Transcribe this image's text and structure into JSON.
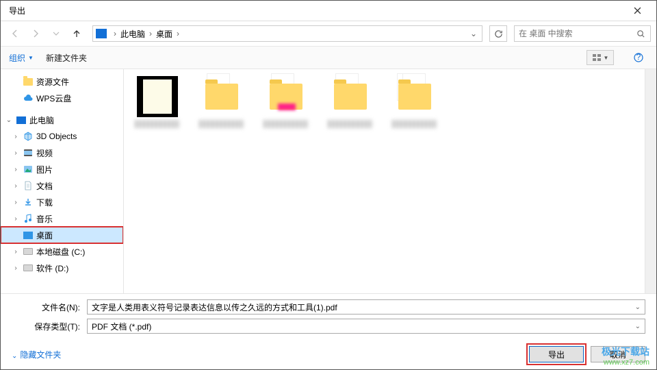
{
  "title": "导出",
  "nav": {
    "crumbs": [
      "此电脑",
      "桌面"
    ],
    "search_placeholder": "在 桌面 中搜索"
  },
  "toolbar": {
    "organize": "组织",
    "new_folder": "新建文件夹"
  },
  "sidebar": [
    {
      "label": "资源文件",
      "icon": "folder",
      "indent": 1,
      "caret": ""
    },
    {
      "label": "WPS云盘",
      "icon": "cloud",
      "indent": 1,
      "caret": ""
    },
    {
      "label": "此电脑",
      "icon": "pc",
      "indent": 0,
      "caret": "v"
    },
    {
      "label": "3D Objects",
      "icon": "3d",
      "indent": 1,
      "caret": ">"
    },
    {
      "label": "视频",
      "icon": "video",
      "indent": 1,
      "caret": ">"
    },
    {
      "label": "图片",
      "icon": "image",
      "indent": 1,
      "caret": ">"
    },
    {
      "label": "文档",
      "icon": "doc",
      "indent": 1,
      "caret": ">"
    },
    {
      "label": "下载",
      "icon": "download",
      "indent": 1,
      "caret": ">"
    },
    {
      "label": "音乐",
      "icon": "music",
      "indent": 1,
      "caret": ">"
    },
    {
      "label": "桌面",
      "icon": "desktop",
      "indent": 1,
      "caret": "",
      "selected": true,
      "highlight": true
    },
    {
      "label": "本地磁盘 (C:)",
      "icon": "disk",
      "indent": 1,
      "caret": ">"
    },
    {
      "label": "软件 (D:)",
      "icon": "disk",
      "indent": 1,
      "caret": ">"
    }
  ],
  "files": [
    {
      "type": "folder",
      "selected": true
    },
    {
      "type": "folder"
    },
    {
      "type": "folder"
    },
    {
      "type": "folder"
    },
    {
      "type": "folder"
    }
  ],
  "form": {
    "filename_label": "文件名(N):",
    "filename_value": "文字是人类用表义符号记录表达信息以传之久远的方式和工具(1).pdf",
    "type_label": "保存类型(T):",
    "type_value": "PDF 文档 (*.pdf)"
  },
  "footer": {
    "hide_folders": "隐藏文件夹",
    "export": "导出",
    "cancel": "取消"
  },
  "watermark": {
    "line1": "极光下载站",
    "line2": "www.xz7.com"
  }
}
